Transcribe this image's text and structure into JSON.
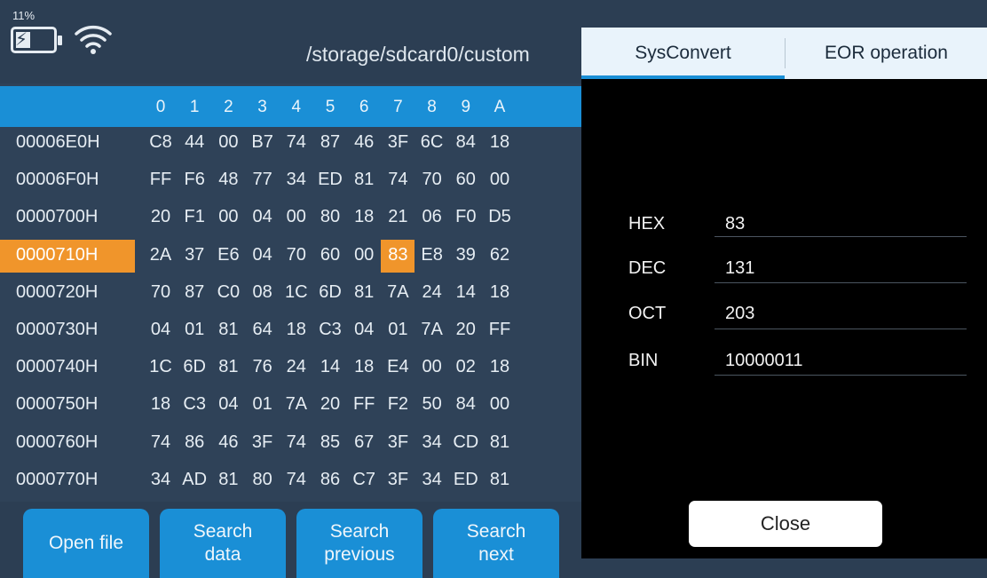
{
  "status": {
    "battery": "11%"
  },
  "path": "/storage/sdcard0/custom",
  "hex": {
    "columns": [
      "0",
      "1",
      "2",
      "3",
      "4",
      "5",
      "6",
      "7",
      "8",
      "9",
      "A"
    ],
    "rows": [
      {
        "addr": "00006E0H",
        "cells": [
          "C8",
          "44",
          "00",
          "B7",
          "74",
          "87",
          "46",
          "3F",
          "6C",
          "84",
          "18"
        ]
      },
      {
        "addr": "00006F0H",
        "cells": [
          "FF",
          "F6",
          "48",
          "77",
          "34",
          "ED",
          "81",
          "74",
          "70",
          "60",
          "00"
        ]
      },
      {
        "addr": "0000700H",
        "cells": [
          "20",
          "F1",
          "00",
          "04",
          "00",
          "80",
          "18",
          "21",
          "06",
          "F0",
          "D5"
        ]
      },
      {
        "addr": "0000710H",
        "cells": [
          "2A",
          "37",
          "E6",
          "04",
          "70",
          "60",
          "00",
          "83",
          "E8",
          "39",
          "62"
        ]
      },
      {
        "addr": "0000720H",
        "cells": [
          "70",
          "87",
          "C0",
          "08",
          "1C",
          "6D",
          "81",
          "7A",
          "24",
          "14",
          "18"
        ]
      },
      {
        "addr": "0000730H",
        "cells": [
          "04",
          "01",
          "81",
          "64",
          "18",
          "C3",
          "04",
          "01",
          "7A",
          "20",
          "FF"
        ]
      },
      {
        "addr": "0000740H",
        "cells": [
          "1C",
          "6D",
          "81",
          "76",
          "24",
          "14",
          "18",
          "E4",
          "00",
          "02",
          "18"
        ]
      },
      {
        "addr": "0000750H",
        "cells": [
          "18",
          "C3",
          "04",
          "01",
          "7A",
          "20",
          "FF",
          "F2",
          "50",
          "84",
          "00"
        ]
      },
      {
        "addr": "0000760H",
        "cells": [
          "74",
          "86",
          "46",
          "3F",
          "74",
          "85",
          "67",
          "3F",
          "34",
          "CD",
          "81"
        ]
      },
      {
        "addr": "0000770H",
        "cells": [
          "34",
          "AD",
          "81",
          "80",
          "74",
          "86",
          "C7",
          "3F",
          "34",
          "ED",
          "81"
        ]
      }
    ]
  },
  "buttons": {
    "open": "Open file",
    "search_data": "Search data",
    "search_previous": "Search previous",
    "search_next": "Search next"
  },
  "dialog": {
    "tabs": [
      "SysConvert",
      "EOR operation"
    ],
    "fields": [
      {
        "label": "HEX",
        "value": "83"
      },
      {
        "label": "DEC",
        "value": "131"
      },
      {
        "label": "OCT",
        "value": "203"
      },
      {
        "label": "BIN",
        "value": "10000011"
      }
    ],
    "close": "Close"
  },
  "colors": {
    "accent": "#1a8fd6",
    "highlight": "#f0952b",
    "background": "#2f4258"
  }
}
